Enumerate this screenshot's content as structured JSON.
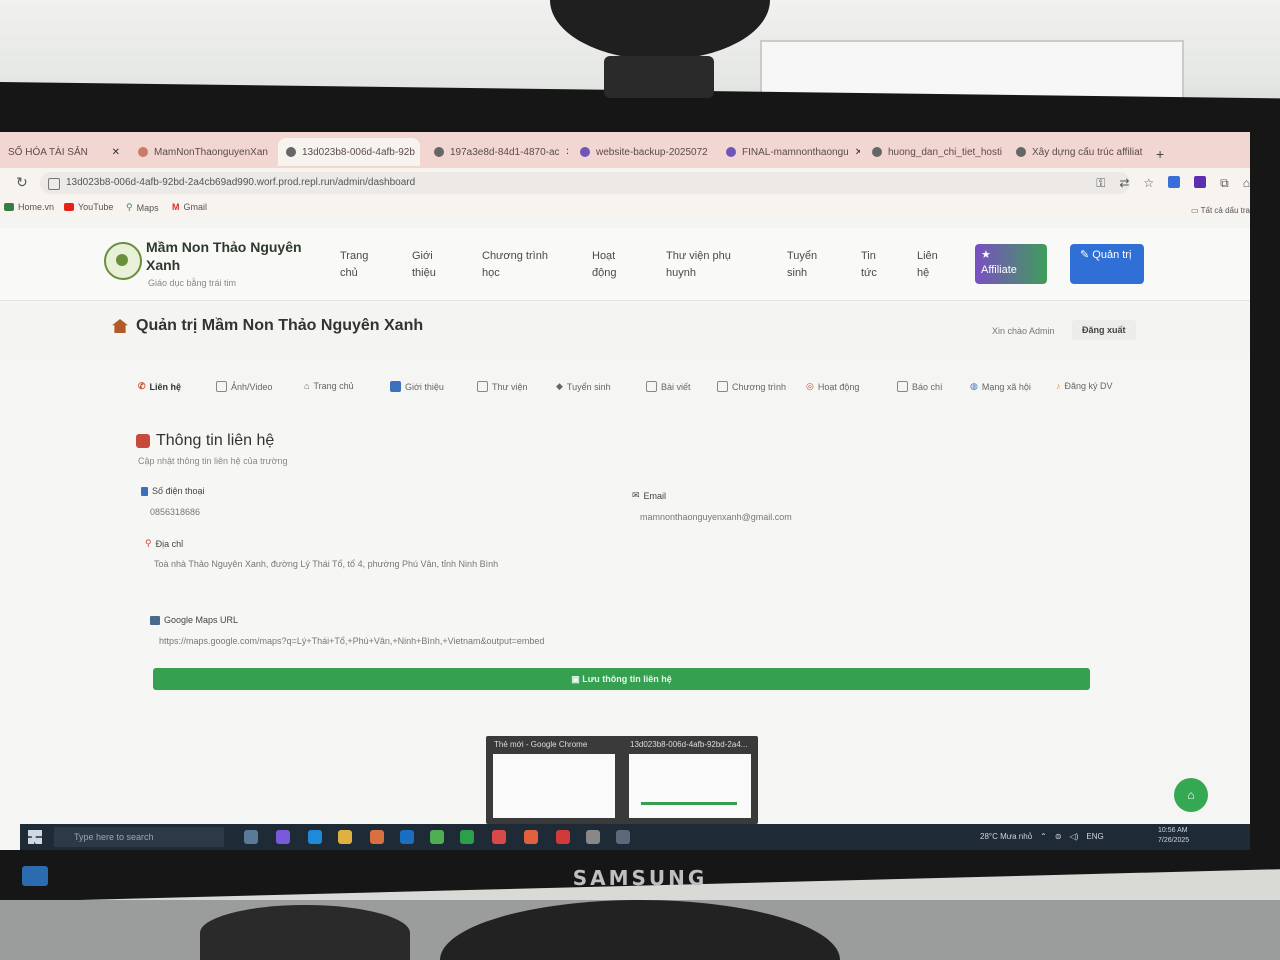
{
  "browser": {
    "tabs": [
      {
        "title": "SỐ HÓA TÀI SẢN",
        "active": false
      },
      {
        "title": "MamNonThaonguyenXan",
        "active": false
      },
      {
        "title": "13d023b8-006d-4afb-92b",
        "active": true
      },
      {
        "title": "197a3e8d-84d1-4870-ac",
        "active": false
      },
      {
        "title": "website-backup-2025072",
        "active": false
      },
      {
        "title": "FINAL-mamnonthaongu",
        "active": false
      },
      {
        "title": "huong_dan_chi_tiet_hosti",
        "active": false
      },
      {
        "title": "Xây dựng cấu trúc affiliat",
        "active": false
      }
    ],
    "url": "13d023b8-006d-4afb-92bd-2a4cb69ad990.worf.prod.repl.run/admin/dashboard",
    "bookmarks": [
      {
        "label": "Home.vn",
        "color": "#3a7d44"
      },
      {
        "label": "YouTube",
        "color": "#e62117"
      },
      {
        "label": "Maps",
        "color": "#2f8f4e"
      },
      {
        "label": "Gmail",
        "color": "#d93025"
      }
    ],
    "bookmarks_right": "Tất cả dấu tra"
  },
  "site": {
    "name": "Mầm Non Thảo Nguyên Xanh",
    "tagline": "Giáo dục bằng trái tim",
    "nav": [
      {
        "label": "Trang chủ"
      },
      {
        "label": "Giới thiệu"
      },
      {
        "label": "Chương trình học"
      },
      {
        "label": "Hoạt động"
      },
      {
        "label": "Thư viện phụ huynh"
      },
      {
        "label": "Tuyển sinh"
      },
      {
        "label": "Tin tức"
      },
      {
        "label": "Liên hệ"
      }
    ],
    "affiliate_label": "Affiliate",
    "admin_label": "Quản trị"
  },
  "admin": {
    "title": "Quản trị Mầm Non Thảo Nguyên Xanh",
    "greeting": "Xin chào Admin",
    "logout": "Đăng xuất",
    "tabs": [
      {
        "label": "Liên hệ"
      },
      {
        "label": "Ảnh/Video"
      },
      {
        "label": "Trang chủ"
      },
      {
        "label": "Giới thiệu"
      },
      {
        "label": "Thư viện"
      },
      {
        "label": "Tuyển sinh"
      },
      {
        "label": "Bài viết"
      },
      {
        "label": "Chương trình"
      },
      {
        "label": "Hoạt động"
      },
      {
        "label": "Báo chí"
      },
      {
        "label": "Mạng xã hội"
      },
      {
        "label": "Đăng ký DV"
      }
    ]
  },
  "contact_form": {
    "title": "Thông tin liên hệ",
    "subtitle": "Cập nhật thông tin liên hệ của trường",
    "phone_label": "Số điện thoại",
    "phone_value": "0856318686",
    "email_label": "Email",
    "email_value": "mamnonthaonguyenxanh@gmail.com",
    "address_label": "Địa chỉ",
    "address_value": "Toà nhà Thảo Nguyên Xanh, đường Lý Thái Tổ, tổ 4, phường Phú Vân, tỉnh Ninh Bình",
    "maps_label": "Google Maps URL",
    "maps_value": "https://maps.google.com/maps?q=Lý+Thái+Tổ,+Phú+Vân,+Ninh+Bình,+Vietnam&output=embed",
    "save_label": "Lưu thông tin liên hệ"
  },
  "thumbnails": [
    {
      "title": "Thẻ mới - Google Chrome"
    },
    {
      "title": "13d023b8-006d-4afb-92bd-2a4..."
    }
  ],
  "taskbar": {
    "search_placeholder": "Type here to search",
    "weather": "28°C  Mưa nhỏ",
    "lang": "ENG",
    "time": "10:56 AM",
    "date": "7/26/2025"
  },
  "monitor_brand": "SAMSUNG",
  "colors": {
    "save_green": "#35a150",
    "admin_blue": "#2f6fd6",
    "affiliate_purple": "#7a4fc2",
    "tab_strip": "#f2d6d2"
  }
}
